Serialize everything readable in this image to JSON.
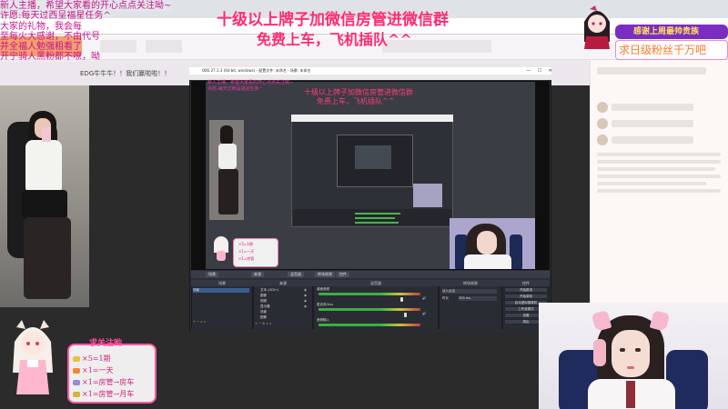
{
  "overlay": {
    "left_lines": [
      "新人主播，希望大家看的开心点点关注呦~",
      "许愿:每天过西呈福星任务^",
      "大家的礼物，我会每",
      "至每火大感谢，不由代号",
      "并全福人勉强粗看了",
      "开宁骑人黑粉都不嘹，呦"
    ],
    "top_center_line1": "十级以上牌子加微信房管进微信群",
    "top_center_line2": "免费上车，飞机插队^^",
    "mid_line1": "十级以上牌子加微信房管进微信群",
    "mid_line2": "免费上车，飞机插队^^"
  },
  "browser": {
    "room_title": "EDG牛牛牛！！我们赢啦啦！！"
  },
  "top_right": {
    "badge": "感谢上周最帅贵族",
    "sub": "求日级粉丝千万吧"
  },
  "gift_board": {
    "title": "求关注哟",
    "rows": [
      {
        "text": "×5=1期",
        "color": "#e8c23a"
      },
      {
        "text": "×1=一天",
        "color": "#f08a3a"
      },
      {
        "text": "×1=房管→房车",
        "color": "#9b8ad8"
      },
      {
        "text": "×1=房管→月车",
        "color": "#d8b23a"
      }
    ]
  },
  "obs": {
    "title": "OBS 27.1.3 (64-bit, windows) - 配置文件: 未命名 - 场景: 未命名",
    "window_controls": "— ☐ ✕",
    "dock_tabs": [
      "场景",
      "来源",
      "混音器",
      "转场效果",
      "控件"
    ],
    "scene_header": "场景",
    "source_header": "来源",
    "mixer_header": "混音器",
    "transition_header": "转场效果",
    "control_header": "控件",
    "scene_item": "场景",
    "sources": [
      "文本 (GDI+)",
      "图像",
      "视频",
      "显示器",
      "场景",
      "图像"
    ],
    "mixer_channels": [
      "桌面音频",
      "麦克风/Aux",
      "音频输入"
    ],
    "transition_value": "淡入淡出",
    "duration_label": "时长",
    "duration_value": "300 ms",
    "controls": [
      "开始推流",
      "开始录制",
      "启动虚拟摄像机",
      "工作室模式",
      "设置",
      "退出"
    ]
  },
  "gift_small": {
    "rows": [
      "×5=1期",
      "×1=一天",
      "×1=房管"
    ]
  }
}
